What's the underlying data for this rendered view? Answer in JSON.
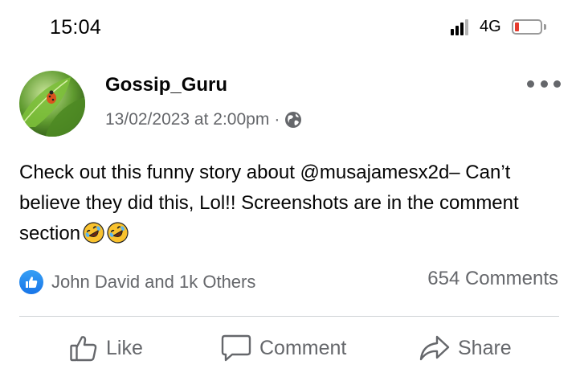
{
  "status_bar": {
    "time": "15:04",
    "network": "4G",
    "signal_icon": "cellular-signal-icon",
    "battery_icon": "battery-low-icon",
    "battery_color": "#e63b2e"
  },
  "post": {
    "author": "Gossip_Guru",
    "timestamp": "13/02/2023 at 2:00pm",
    "separator": "·",
    "privacy_icon": "globe-icon",
    "text": "Check out this funny story about @musajamesx2d– Can’t believe they did this, Lol!! Screenshots are in the comment section",
    "emojis": [
      "rolling-on-floor-laughing-emoji",
      "rolling-on-floor-laughing-emoji"
    ],
    "reactions_text": "John David and 1k Others",
    "comments_text": "654 Comments"
  },
  "actions": {
    "like": "Like",
    "comment": "Comment",
    "share": "Share"
  },
  "colors": {
    "accent": "#1877f2",
    "muted_text": "#65676b",
    "divider": "#cfd2d6"
  }
}
